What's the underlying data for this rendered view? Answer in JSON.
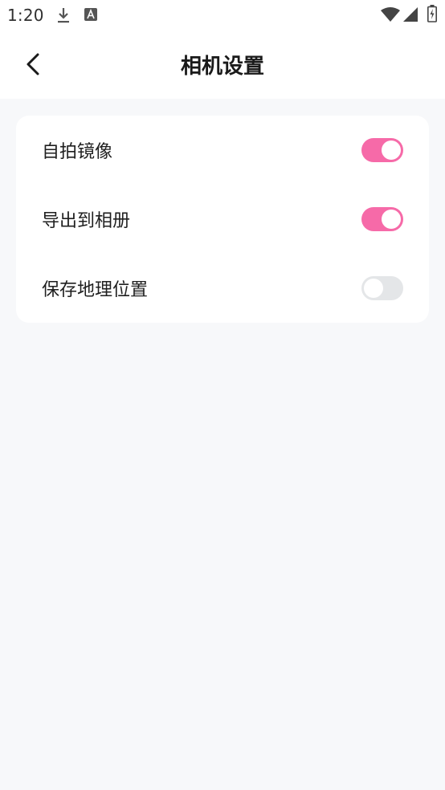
{
  "status_bar": {
    "time": "1:20",
    "icons": [
      "download-icon",
      "font-a-icon",
      "wifi-icon",
      "signal-icon",
      "battery-icon"
    ]
  },
  "header": {
    "title": "相机设置",
    "back_icon": "chevron-left-icon"
  },
  "settings": [
    {
      "label": "自拍镜像",
      "enabled": true
    },
    {
      "label": "导出到相册",
      "enabled": true
    },
    {
      "label": "保存地理位置",
      "enabled": false
    }
  ],
  "colors": {
    "accent": "#f66aa8",
    "toggle_off": "#e4e6e8",
    "background": "#f7f8fa",
    "card": "#ffffff"
  }
}
